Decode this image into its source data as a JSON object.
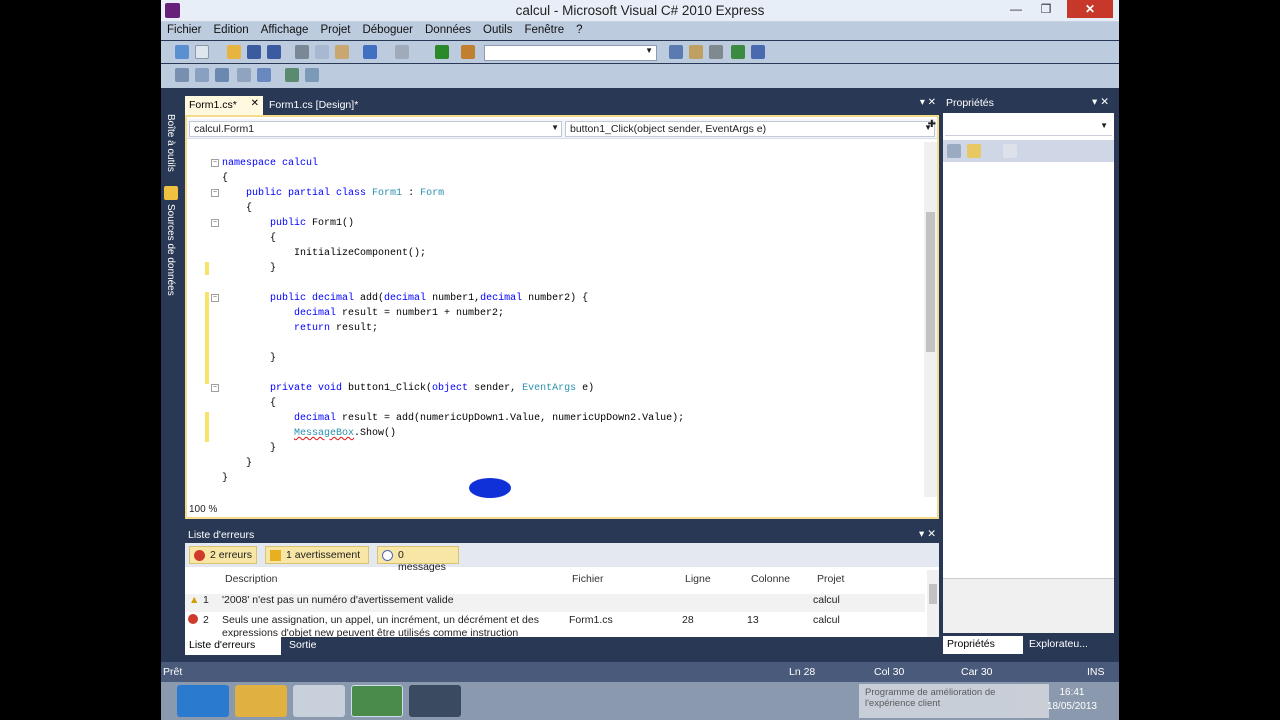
{
  "window": {
    "title": "calcul - Microsoft Visual C# 2010 Express",
    "minimize": "—",
    "maximize": "❒",
    "close": "✕"
  },
  "menu": [
    "Fichier",
    "Edition",
    "Affichage",
    "Projet",
    "Déboguer",
    "Données",
    "Outils",
    "Fenêtre",
    "?"
  ],
  "side": {
    "toolbox": "Boîte à outils",
    "datasources": "Sources de données"
  },
  "tabs": {
    "active": "Form1.cs*",
    "inactive": "Form1.cs [Design]*",
    "close": "✕",
    "menu": "▾ ✕"
  },
  "nav": {
    "left": "calcul.Form1",
    "right": "button1_Click(object sender, EventArgs e)"
  },
  "code": {
    "l1": "namespace calcul",
    "l2": "{",
    "l3_kw": "public partial class ",
    "l3_ty": "Form1",
    "l3_sep": " : ",
    "l3_base": "Form",
    "l4": "{",
    "l5_kw": "public ",
    "l5_rest": "Form1()",
    "l6": "{",
    "l7": "InitializeComponent();",
    "l8": "}",
    "l9_kw1": "public decimal ",
    "l9_a": "add(",
    "l9_kw2": "decimal",
    "l9_b": " number1,",
    "l9_kw3": "decimal",
    "l9_c": " number2) {",
    "l10_kw": "decimal ",
    "l10_rest": "result = number1 + number2;",
    "l11_kw": "return ",
    "l11_rest": "result;",
    "l12": "}",
    "l13_kw1": "private void ",
    "l13_a": "button1_Click(",
    "l13_kw2": "object",
    "l13_b": " sender, ",
    "l13_ty": "EventArgs",
    "l13_c": " e)",
    "l14": "{",
    "l15_kw": "decimal ",
    "l15_rest": "result = add(numericUpDown1.Value, numericUpDown2.Value);",
    "l16_ty": "MessageBox",
    "l16_rest": ".Show()",
    "l17": "}",
    "l18": "}",
    "l19": "}"
  },
  "zoom": "100 %",
  "properties": {
    "title": "Propriétés",
    "tab_props": "Propriétés",
    "tab_explorer": "Explorateu..."
  },
  "errors": {
    "title": "Liste d'erreurs",
    "filters": {
      "errors": "2 erreurs",
      "warnings": "1 avertissement",
      "messages": "0 messages"
    },
    "columns": {
      "description": "Description",
      "file": "Fichier",
      "line": "Ligne",
      "column": "Colonne",
      "project": "Projet"
    },
    "rows": [
      {
        "num": "1",
        "description": "'2008' n'est pas un numéro d'avertissement valide",
        "file": "",
        "line": "",
        "column": "",
        "project": "calcul"
      },
      {
        "num": "2",
        "description": "Seuls une assignation, un appel, un incrément, un décrément et des",
        "description2": "expressions d'objet new peuvent être utilisés comme instruction",
        "file": "Form1.cs",
        "line": "28",
        "column": "13",
        "project": "calcul"
      }
    ],
    "tab_errors": "Liste d'erreurs",
    "tab_output": "Sortie"
  },
  "status": {
    "ready": "Prêt",
    "ln": "Ln 28",
    "col": "Col 30",
    "car": "Car 30",
    "mode": "INS"
  },
  "taskbar": {
    "notification": "Programme de amélioration de l'expérience client",
    "time": "16:41",
    "date": "18/05/2013"
  },
  "colors": {
    "accent": "#293955",
    "tab_active": "#fff9e0",
    "keyword": "#0000ff",
    "type": "#2b91af"
  }
}
